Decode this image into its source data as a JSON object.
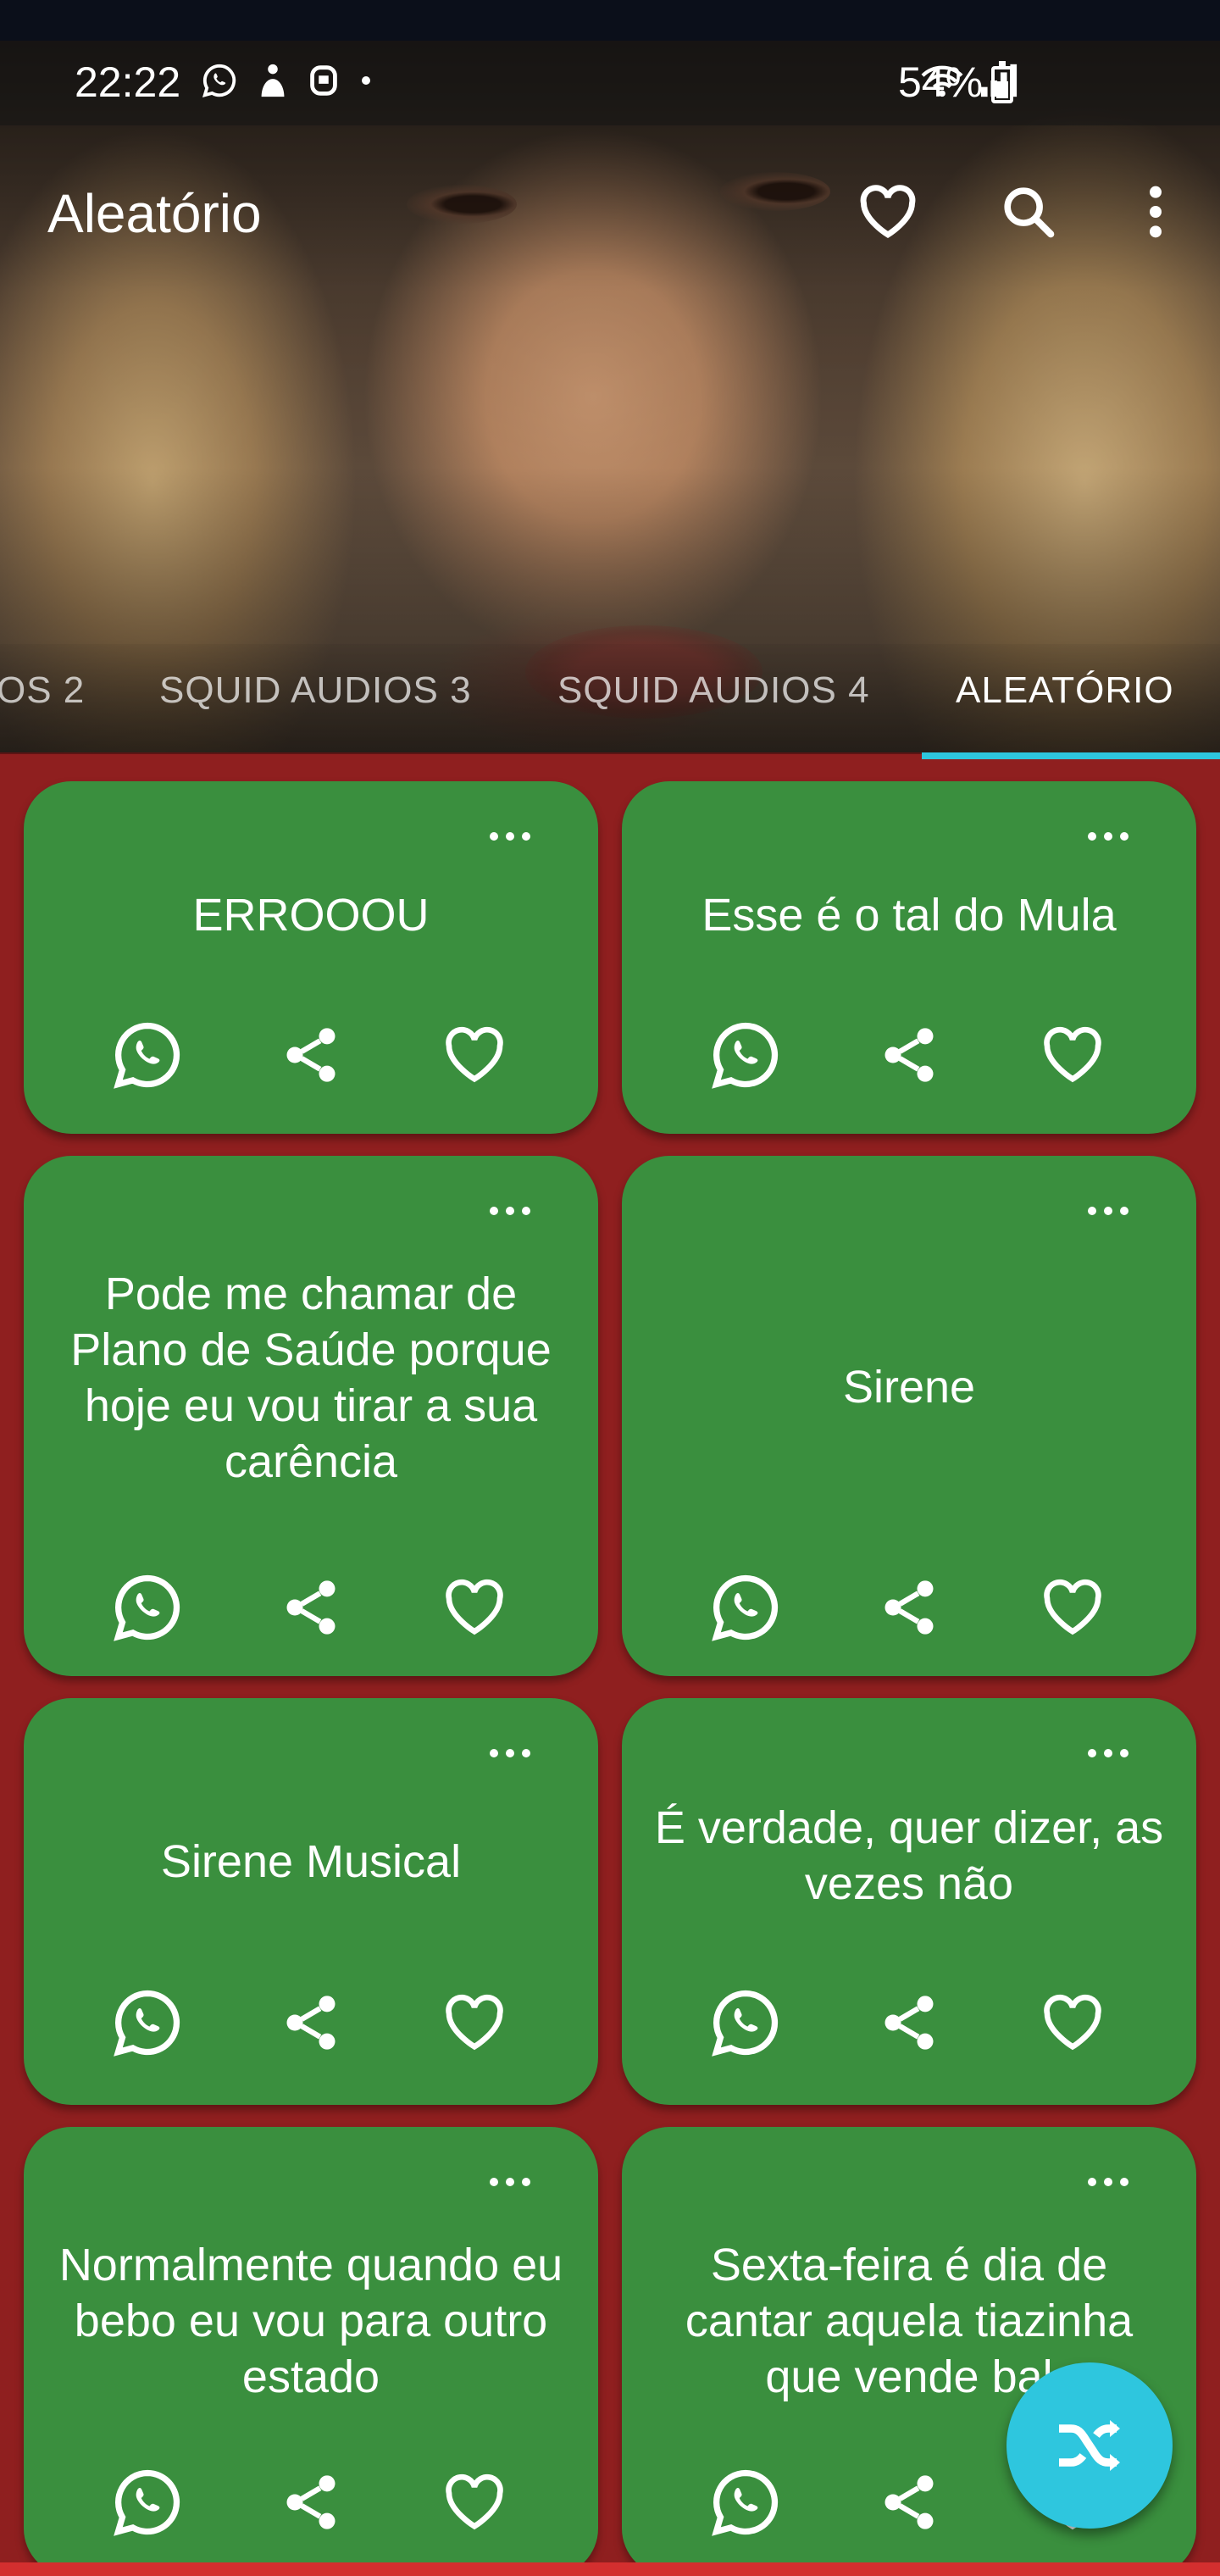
{
  "status_bar": {
    "time": "22:22",
    "left_icons": [
      "whatsapp-icon",
      "notification-app-icon",
      "notification-app-icon-2",
      "dot-icon"
    ],
    "right_icons": [
      "wifi-icon",
      "signal-icon"
    ],
    "battery_text": "54%"
  },
  "app_bar": {
    "title": "Aleatório",
    "actions": [
      "favorite-icon",
      "search-icon",
      "more-vert-icon"
    ]
  },
  "tabs": [
    {
      "label": "OS 2",
      "active": false
    },
    {
      "label": "SQUID AUDIOS 3",
      "active": false
    },
    {
      "label": "SQUID AUDIOS 4",
      "active": false
    },
    {
      "label": "ALEATÓRIO",
      "active": true
    }
  ],
  "cards": [
    {
      "title": "ERROOOU"
    },
    {
      "title": "Esse é o tal do Mula"
    },
    {
      "title": "Pode me chamar de Plano de Saúde porque hoje eu vou tirar a sua carência"
    },
    {
      "title": "Sirene"
    },
    {
      "title": "Sirene Musical"
    },
    {
      "title": "É verdade, quer dizer, as vezes não"
    },
    {
      "title": "Normalmente quando eu bebo eu vou para outro estado"
    },
    {
      "title": "Sexta-feira é dia de cantar aquela tiazinha que vende bal"
    }
  ],
  "card_actions": [
    "whatsapp-icon",
    "share-icon",
    "favorite-icon"
  ],
  "fab": {
    "icon": "shuffle-icon"
  },
  "colors": {
    "background": "#8f1f1f",
    "card": "#3a8f3e",
    "accent": "#2ec6de"
  }
}
